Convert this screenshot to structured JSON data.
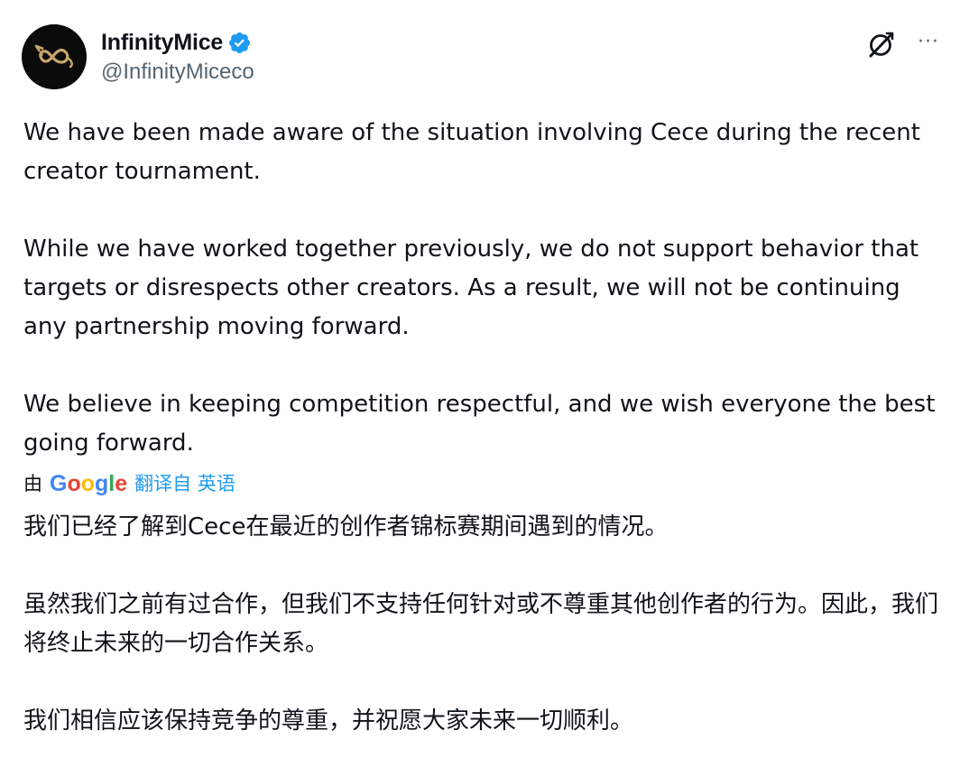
{
  "author": {
    "display_name": "InfinityMice",
    "handle": "@InfinityMiceco",
    "verified": true
  },
  "colors": {
    "verified_badge": "#1d9bf0",
    "link": "#1d9bf0",
    "secondary_text": "#536471"
  },
  "icons": {
    "grok": "grok-icon",
    "more": "more-options-icon",
    "verified": "verified-badge-icon",
    "avatar_logo": "infinity-mouse-logo"
  },
  "post": {
    "paragraphs": [
      "We have been made aware of the situation involving Cece during the recent creator tournament.",
      "While we have worked together previously, we do not support behavior that targets or disrespects other creators. As a result, we will not be continuing any partnership moving forward.",
      "We believe in keeping competition respectful, and we wish everyone the best going forward."
    ]
  },
  "translation": {
    "by_label": "由",
    "provider": "Google",
    "source_label": "翻译自 英语",
    "paragraphs": [
      "我们已经了解到Cece在最近的创作者锦标赛期间遇到的情况。",
      "虽然我们之前有过合作，但我们不支持任何针对或不尊重其他创作者的行为。因此，我们将终止未来的一切合作关系。",
      "我们相信应该保持竞争的尊重，并祝愿大家未来一切顺利。"
    ]
  },
  "more_glyph": "···"
}
